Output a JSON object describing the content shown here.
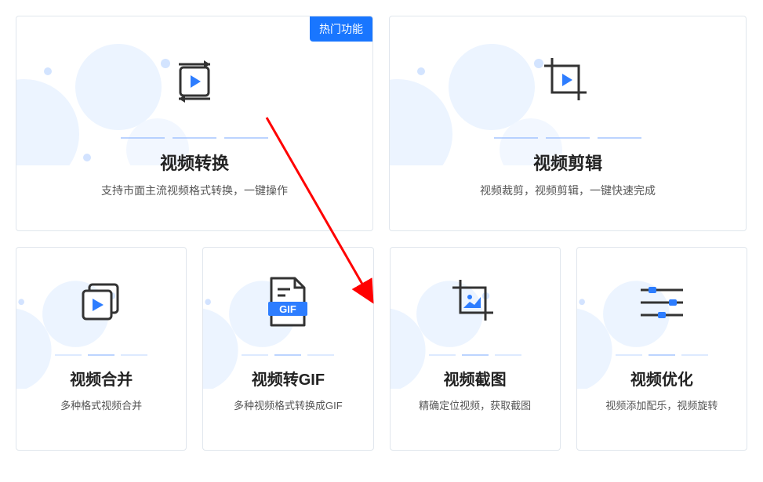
{
  "badge_label": "热门功能",
  "features": {
    "convert": {
      "title": "视频转换",
      "desc": "支持市面主流视频格式转换，一键操作"
    },
    "trim": {
      "title": "视频剪辑",
      "desc": "视频裁剪，视频剪辑，一键快速完成"
    },
    "merge": {
      "title": "视频合并",
      "desc": "多种格式视频合并"
    },
    "gif": {
      "title": "视频转GIF",
      "desc": "多种视频格式转换成GIF",
      "badge_text": "GIF"
    },
    "screenshot": {
      "title": "视频截图",
      "desc": "精确定位视频，获取截图"
    },
    "optimize": {
      "title": "视频优化",
      "desc": "视频添加配乐，视频旋转"
    }
  }
}
